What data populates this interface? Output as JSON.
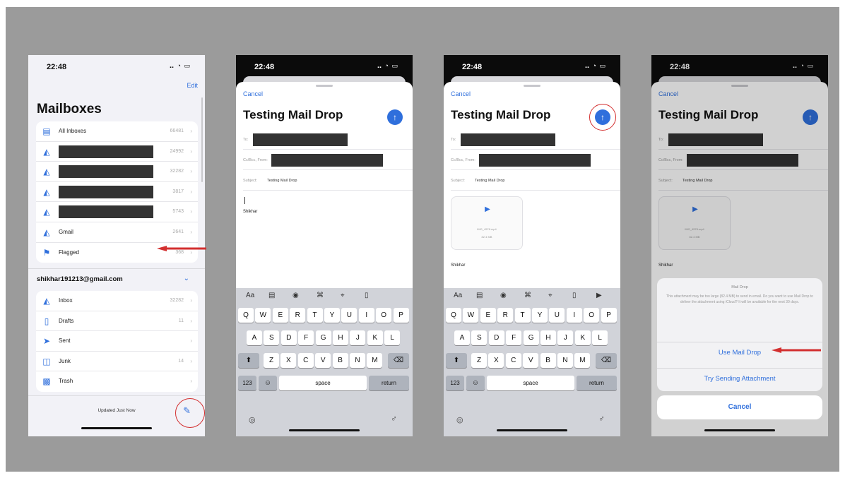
{
  "status": {
    "time": "22:48",
    "indicators": "‥ ◔ ▭"
  },
  "mailboxes": {
    "edit": "Edit",
    "title": "Mailboxes",
    "items": [
      {
        "label": "All Inboxes",
        "count": "66481",
        "icon": "inbox-stack-icon"
      },
      {
        "label": "",
        "count": "24992",
        "icon": "inbox-icon",
        "redacted": true
      },
      {
        "label": "",
        "count": "32282",
        "icon": "inbox-icon",
        "redacted": true
      },
      {
        "label": "",
        "count": "3817",
        "icon": "inbox-icon",
        "redacted": true
      },
      {
        "label": "",
        "count": "5743",
        "icon": "inbox-icon",
        "redacted": true
      },
      {
        "label": "Gmail",
        "count": "2641",
        "icon": "inbox-icon"
      },
      {
        "label": "Flagged",
        "count": "368",
        "icon": "flag-icon"
      }
    ],
    "account": "shikhar191213@gmail.com",
    "account_items": [
      {
        "label": "Inbox",
        "count": "32282",
        "icon": "inbox-icon"
      },
      {
        "label": "Drafts",
        "count": "11",
        "icon": "document-icon"
      },
      {
        "label": "Sent",
        "count": "",
        "icon": "paperplane-icon"
      },
      {
        "label": "Junk",
        "count": "14",
        "icon": "junk-icon"
      },
      {
        "label": "Trash",
        "count": "",
        "icon": "trash-icon"
      }
    ],
    "updated": "Updated Just Now"
  },
  "compose": {
    "cancel": "Cancel",
    "title": "Testing Mail Drop",
    "to_label": "To:",
    "cc_label": "Cc/Bcc, From:",
    "subject_label": "Subject:",
    "subject": "Testing Mail Drop",
    "signature": "Shikhar",
    "attachment_name": "IMG_4578.mp4",
    "attachment_size": "82.4 MB"
  },
  "keyboard": {
    "tools": [
      "Aa",
      "▤",
      "◉",
      "⌘",
      "⌖",
      "▯",
      "▶"
    ],
    "row1": [
      "Q",
      "W",
      "E",
      "R",
      "T",
      "Y",
      "U",
      "I",
      "O",
      "P"
    ],
    "row2": [
      "A",
      "S",
      "D",
      "F",
      "G",
      "H",
      "J",
      "K",
      "L"
    ],
    "row3": [
      "Z",
      "X",
      "C",
      "V",
      "B",
      "N",
      "M"
    ],
    "shift": "⬆",
    "delete": "⌫",
    "num": "123",
    "emoji": "☺",
    "space": "space",
    "return": "return",
    "globe": "◎",
    "mic": "♂"
  },
  "maildrop": {
    "title": "Mail Drop",
    "message": "This attachment may be too large (82.4 MB) to send in email. Do you want to use Mail Drop to deliver the attachment using iCloud? It will be available for the next 30 days.",
    "use": "Use Mail Drop",
    "try": "Try Sending Attachment",
    "cancel": "Cancel"
  },
  "colors": {
    "accent": "#2f6fdc",
    "annotation": "#d32f2f"
  }
}
